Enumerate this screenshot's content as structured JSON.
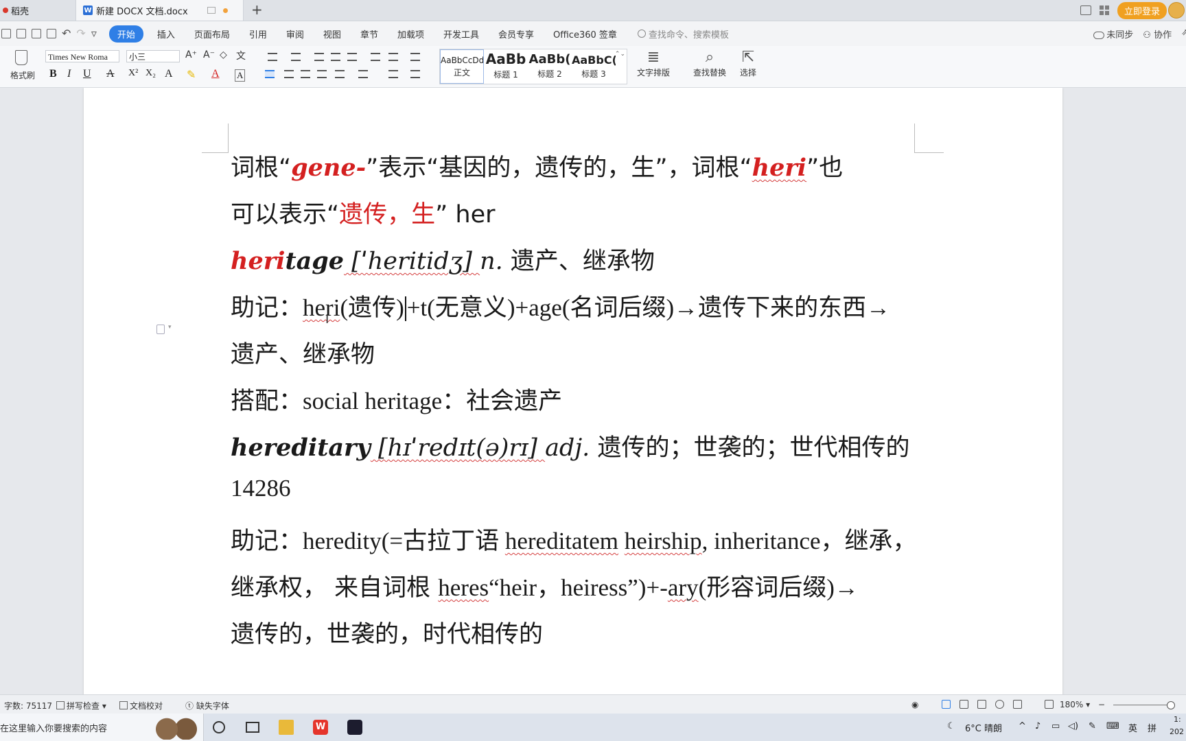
{
  "tabs": {
    "home_label": "稻壳",
    "doc_label": "新建 DOCX 文档.docx",
    "new_tab": "+"
  },
  "header_right": {
    "login": "立即登录"
  },
  "menu": {
    "items": [
      "开始",
      "插入",
      "页面布局",
      "引用",
      "审阅",
      "视图",
      "章节",
      "加载项",
      "开发工具",
      "会员专享",
      "Office360 签章"
    ],
    "search_placeholder": "查找命令、搜索模板",
    "sync": "未同步",
    "collab": "协作"
  },
  "toolbar": {
    "format_brush": "格式刷",
    "font": "Times New Roma",
    "size": "小三",
    "bold": "B",
    "italic": "I",
    "underline": "U",
    "styles": [
      {
        "preview": "AaBbCcDd",
        "label": "正文"
      },
      {
        "preview": "AaBb",
        "label": "标题 1"
      },
      {
        "preview": "AaBb(",
        "label": "标题 2"
      },
      {
        "preview": "AaBbC(",
        "label": "标题 3"
      }
    ],
    "text_layout": "文字排版",
    "find_replace": "查找替换",
    "select": "选择"
  },
  "doc": {
    "l1_a": "词根“",
    "l1_b": "gene-",
    "l1_c": "”表示“基因的，遗传的，生”，词根“",
    "l1_d": "heri",
    "l1_e": "”也",
    "l2_a": "可以表示“",
    "l2_b": "遗传，生",
    "l2_c": "”  her",
    "l3_a": "heri",
    "l3_b": "tage",
    "l3_c": " [ˈheritidʒ] ",
    "l3_d": "n.",
    "l3_e": " 遗产、继承物",
    "l4_a": "助记：",
    "l4_b": "heri",
    "l4_c": "(遗传)",
    "l4_d": "+t(无意义)+age(名词后缀)→遗传下来的东西→",
    "l5": "遗产、继承物",
    "l6_a": "搭配：",
    "l6_b": "social heritage",
    "l6_c": "：社会遗产",
    "l7_a": "hereditary",
    "l7_b": " [hɪˈredɪt(ə)rɪ] ",
    "l7_c": "adj.",
    "l7_d": " 遗传的；世袭的；世代相传的",
    "l8": "14286",
    "l9_a": "助记：",
    "l9_b": "heredity(=古拉丁语 ",
    "l9_c": "hereditatem",
    "l9_d": " ",
    "l9_e": "heirship",
    "l9_f": ", inheritance，继承，",
    "l10_a": "继承权，  来自词根 ",
    "l10_b": "heres",
    "l10_c": "“heir，heiress”)+-",
    "l10_d": "ary",
    "l10_e": "(形容词后缀)→",
    "l11": "遗传的，世袭的，时代相传的"
  },
  "status": {
    "word_count": "字数: 75117",
    "spell_check": "拼写检查",
    "proofread": "文档校对",
    "missing_font": "缺失字体",
    "zoom": "180%"
  },
  "taskbar": {
    "search": "在这里输入你要搜索的内容",
    "weather": "6°C 晴朗",
    "ime": "英",
    "ime2": "拼",
    "time": "1:",
    "date": "202"
  },
  "colors": {
    "accent": "#2f7fe6",
    "red_text": "#d42020",
    "login": "#f0a020"
  }
}
